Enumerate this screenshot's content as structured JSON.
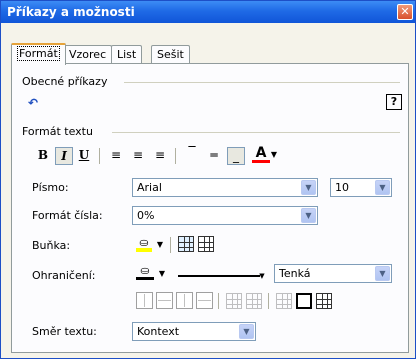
{
  "window": {
    "title": "Příkazy a možnosti",
    "close": "✕"
  },
  "tabs": [
    {
      "label": "Formát",
      "active": true
    },
    {
      "label": "Vzorec"
    },
    {
      "label": "List"
    },
    {
      "label": "Sešit"
    }
  ],
  "sections": {
    "general": "Obecné příkazy",
    "text_format": "Formát textu"
  },
  "toolbar": {
    "bold": "B",
    "italic": "I",
    "underline": "U",
    "align_left": "≡",
    "align_center": "≡",
    "align_right": "≡",
    "font_color_label": "A",
    "undo_icon": "↶",
    "help_icon": "?"
  },
  "fields": {
    "font": {
      "label": "Písmo:",
      "value": "Arial"
    },
    "size": {
      "value": "10"
    },
    "number_format": {
      "label": "Formát čísla:",
      "value": "0%"
    },
    "cell": {
      "label": "Buňka:"
    },
    "borders": {
      "label": "Ohraničení:",
      "style": "Tenká"
    },
    "text_direction": {
      "label": "Směr textu:",
      "value": "Kontext"
    }
  },
  "colors": {
    "accent": "#1f6ae6",
    "font_color": "#ff0000",
    "fill_color": "#ffff00"
  }
}
